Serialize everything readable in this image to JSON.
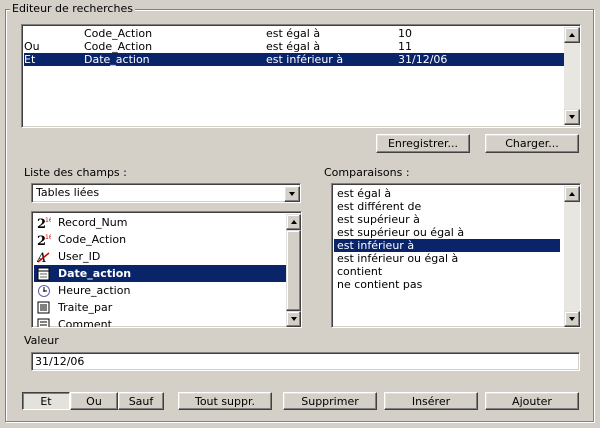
{
  "group_title": "Editeur de recherches",
  "criteria": [
    {
      "connector": "",
      "field": "Code_Action",
      "operator": "est égal à",
      "value": "10",
      "selected": false
    },
    {
      "connector": "Ou",
      "field": "Code_Action",
      "operator": "est égal à",
      "value": "11",
      "selected": false
    },
    {
      "connector": "Et",
      "field": "Date_action",
      "operator": "est inférieur à",
      "value": "31/12/06",
      "selected": true
    }
  ],
  "buttons_top": {
    "save": "Enregistrer...",
    "load": "Charger..."
  },
  "fields_section": {
    "label": "Liste des champs :",
    "table_select": "Tables liées",
    "fields": [
      {
        "label": "Record_Num",
        "icon": "integer-icon"
      },
      {
        "label": "Code_Action",
        "icon": "integer-icon"
      },
      {
        "label": "User_ID",
        "icon": "text-icon"
      },
      {
        "label": "Date_action",
        "icon": "date-icon"
      },
      {
        "label": "Heure_action",
        "icon": "time-icon"
      },
      {
        "label": "Traite_par",
        "icon": "boolean-icon"
      },
      {
        "label": "Comment",
        "icon": "text-block-icon"
      }
    ],
    "selected_index": 3
  },
  "comparisons_section": {
    "label": "Comparaisons :",
    "items": [
      "est égal à",
      "est différent de",
      "est supérieur à",
      "est supérieur ou égal à",
      "est inférieur à",
      "est inférieur ou égal à",
      "contient",
      "ne contient pas"
    ],
    "selected_index": 4
  },
  "value_section": {
    "label": "Valeur",
    "value": "31/12/06"
  },
  "bottom_buttons": {
    "et": "Et",
    "ou": "Ou",
    "sauf": "Sauf",
    "clear_all": "Tout suppr.",
    "delete": "Supprimer",
    "insert": "Insérer",
    "add": "Ajouter"
  },
  "colors": {
    "face": "#d4d0c8",
    "selection": "#0a246a",
    "field_icon_accent": "#cc0000"
  }
}
